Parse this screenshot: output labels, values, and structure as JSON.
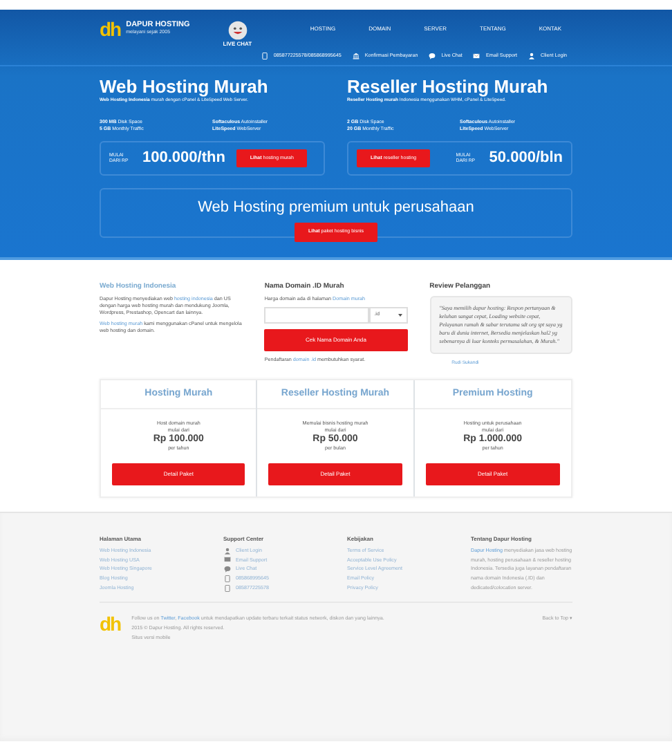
{
  "header": {
    "logo": {
      "mark": "dh",
      "name": "DAPUR HOSTING",
      "tagline": "melayani sejak 2005"
    },
    "live_chat": "LIVE CHAT",
    "nav": [
      {
        "label": "HOSTING"
      },
      {
        "label": "DOMAIN"
      },
      {
        "label": "SERVER"
      },
      {
        "label": "TENTANG"
      },
      {
        "label": "KONTAK"
      }
    ],
    "contacts": [
      {
        "kind": "phone",
        "label": "085877225578/085868995645"
      },
      {
        "kind": "bank",
        "label": "Konfirmasi Pembayaran"
      },
      {
        "kind": "chat",
        "label": "Live Chat"
      },
      {
        "kind": "mail",
        "label": "Email Support"
      },
      {
        "kind": "user",
        "label": "Client Login"
      }
    ]
  },
  "hero": [
    {
      "title": "Web Hosting Murah",
      "subtitle": "**Web Hosting Indonesia** murah dengan cPanel & LiteSpeed Web Server.",
      "features": [
        "**300 MB** Disk Space",
        "**Softaculous** Autoinstaller",
        "**5 GB** Monthly Traffic",
        "**LiteSpeed** WebServer"
      ],
      "price_note": "MULAI DARI RP",
      "price": "100.000/thn",
      "button": "**Lihat** hosting murah"
    },
    {
      "title": "Reseller Hosting Murah",
      "subtitle": "**Reseller Hosting murah** Indonesia menggunakan WHM, cPanel & LiteSpeed.",
      "features": [
        "**2 GB** Disk Space",
        "**Softaculous** Autoinstaller",
        "**20 GB** Monthly Traffic",
        "**LiteSpeed** WebServer"
      ],
      "price_note": "MULAI DARI RP",
      "price": "50.000/bln",
      "button": "**Lihat** reseller hosting"
    }
  ],
  "premium": {
    "title": "Web Hosting premium untuk perusahaan",
    "button": "**Lihat** paket hosting bisnis"
  },
  "info": {
    "about": {
      "title": "Web Hosting Indonesia",
      "paragraphs": [
        [
          {
            "text": "Dapur Hosting menyediakan web "
          },
          {
            "text": "hosting indonesia",
            "link": true
          },
          {
            "text": " dan US dengan harga web hosting murah dan mendukung Joomla, Wordpress, Prestashop, Opencart dan lainnya."
          }
        ],
        [
          {
            "text": "Web hosting murah",
            "link": true
          },
          {
            "text": " kami menggunakan cPanel untuk mengelola web hosting dan domain."
          }
        ]
      ]
    },
    "domain": {
      "title": "Nama Domain .ID Murah",
      "intro": [
        {
          "text": "Harga domain ada di halaman "
        },
        {
          "text": "Domain murah",
          "link": true
        }
      ],
      "extension": ".id",
      "button": "Cek Nama Domain Anda",
      "note": [
        {
          "text": "Pendaftaran "
        },
        {
          "text": "domain .id",
          "link": true
        },
        {
          "text": " membutuhkan syarat."
        }
      ]
    },
    "review": {
      "title": "Review Pelanggan",
      "quote": "\"Saya memilih dapur hosting: Respon pertanyaan & keluhan sangat cepat, Loading website cepat, Pelayanan ramah & sabar terutama sdt org spt saya yg baru di dunia internet, Bersedia menjelaskan hal2 yg sebenarnya di luar konteks permasalahan, & Murah.\"",
      "author": "Rudi Sukandi"
    }
  },
  "plans": [
    {
      "title": "Hosting Murah",
      "description": "Host domain murah",
      "from": "mulai dari",
      "price": "Rp 100.000",
      "period": "per tahun",
      "button": "Detail Paket"
    },
    {
      "title": "Reseller Hosting Murah",
      "description": "Memulai bisnis hosting murah",
      "from": "mulai dari",
      "price": "Rp 50.000",
      "period": "per bulan",
      "button": "Detail Paket"
    },
    {
      "title": "Premium Hosting",
      "description": "Hosting untuk perusahaan",
      "from": "mulai dari",
      "price": "Rp 1.000.000",
      "period": "per tahun",
      "button": "Detail Paket"
    }
  ],
  "footer": {
    "columns": [
      {
        "title": "Halaman Utama",
        "links": [
          {
            "label": "Web Hosting Indonesia"
          },
          {
            "label": "Web Hosting USA"
          },
          {
            "label": "Web Hosting Singapore"
          },
          {
            "label": "Blog Hosting"
          },
          {
            "label": "Joomla Hosting"
          }
        ]
      },
      {
        "title": "Support Center",
        "links": [
          {
            "kind": "user",
            "label": "Client Login"
          },
          {
            "kind": "mail",
            "label": "Email Support"
          },
          {
            "kind": "chat",
            "label": "Live Chat"
          },
          {
            "kind": "phone",
            "label": "085868995645"
          },
          {
            "kind": "phone",
            "label": "085877225578"
          }
        ]
      },
      {
        "title": "Kebijakan",
        "links": [
          {
            "label": "Terms of Service"
          },
          {
            "label": "Acceptable Use Policy"
          },
          {
            "label": "Service Level Agreement"
          },
          {
            "label": "Email Policy"
          },
          {
            "label": "Privacy Policy"
          }
        ]
      }
    ],
    "about": {
      "title": "Tentang Dapur Hosting",
      "text": [
        {
          "text": "Dapur Hosting",
          "link": true
        },
        {
          "text": " menyediakan jasa web hosting murah, hosting perusahaan & reseller hosting Indonesia. Tersedia juga layanan pendaftaran nama domain Indonesia (.ID) dan dedicated/colocation server."
        }
      ]
    },
    "follow": [
      {
        "text": "Follow us on "
      },
      {
        "text": "Twitter",
        "link": true
      },
      {
        "text": ", "
      },
      {
        "text": "Facebook",
        "link": true
      },
      {
        "text": " untuk mendapatkan update terbaru terkait status network, diskon dan yang lainnya."
      }
    ],
    "logo_mark": "dh",
    "copyright": "2015 © Dapur Hosting. All rights reserved.",
    "mobile_link": "Situs versi mobile",
    "back_to_top": "Back to Top ▾"
  }
}
